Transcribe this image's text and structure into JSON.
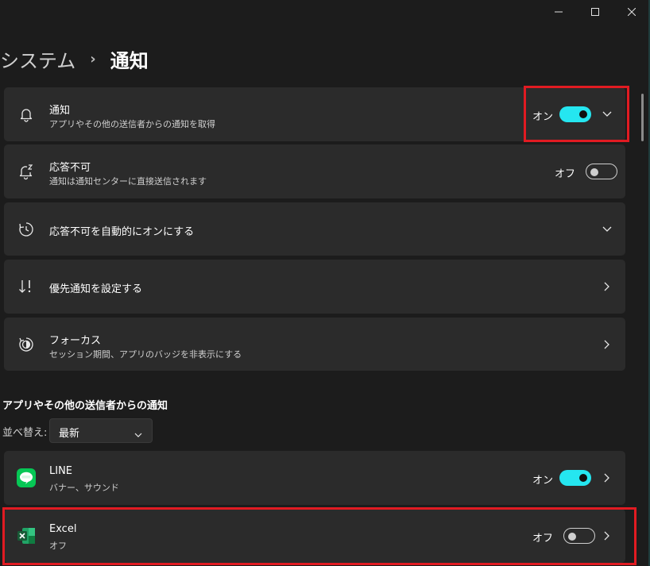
{
  "window": {
    "minimize_icon": "minimize-icon",
    "maximize_icon": "maximize-icon",
    "close_icon": "close-icon"
  },
  "breadcrumb": {
    "parent": "システム",
    "separator": "›",
    "current": "通知"
  },
  "settings": [
    {
      "title": "通知",
      "subtitle": "アプリやその他の送信者からの通知を取得",
      "status": "オン",
      "icon": "bell-icon"
    },
    {
      "title": "応答不可",
      "subtitle": "通知は通知センターに直接送信されます",
      "status": "オフ",
      "icon": "bell-zz-icon"
    },
    {
      "title": "応答不可を自動的にオンにする",
      "icon": "clock-icon"
    },
    {
      "title": "優先通知を設定する",
      "icon": "priority-sort-icon"
    },
    {
      "title": "フォーカス",
      "subtitle": "セッション期間、アプリのバッジを非表示にする",
      "icon": "focus-icon"
    }
  ],
  "apps_section": {
    "title": "アプリやその他の送信者からの通知",
    "sort_label": "並べ替え:",
    "sort_value": "最新",
    "apps": [
      {
        "name": "LINE",
        "subtitle": "バナー、サウンド",
        "status": "オン",
        "icon": "line-app-icon"
      },
      {
        "name": "Excel",
        "subtitle": "オフ",
        "status": "オフ",
        "icon": "excel-app-icon"
      }
    ]
  },
  "colors": {
    "accent": "#25e6f0",
    "highlight_box": "#e11b22",
    "card": "#2b2b2b",
    "background": "#1c1c1c"
  }
}
